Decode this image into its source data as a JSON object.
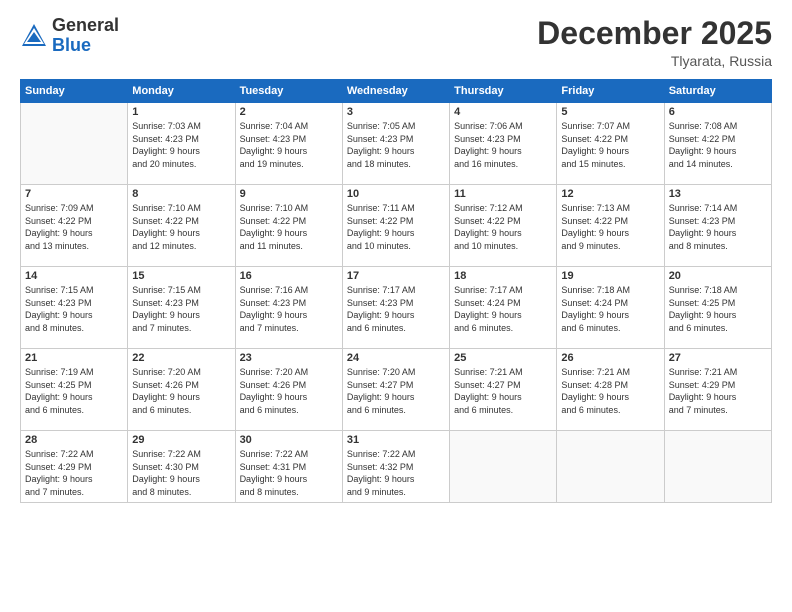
{
  "logo": {
    "general": "General",
    "blue": "Blue"
  },
  "header": {
    "month": "December 2025",
    "location": "Tlyarata, Russia"
  },
  "weekdays": [
    "Sunday",
    "Monday",
    "Tuesday",
    "Wednesday",
    "Thursday",
    "Friday",
    "Saturday"
  ],
  "weeks": [
    [
      {
        "day": "",
        "info": ""
      },
      {
        "day": "1",
        "info": "Sunrise: 7:03 AM\nSunset: 4:23 PM\nDaylight: 9 hours\nand 20 minutes."
      },
      {
        "day": "2",
        "info": "Sunrise: 7:04 AM\nSunset: 4:23 PM\nDaylight: 9 hours\nand 19 minutes."
      },
      {
        "day": "3",
        "info": "Sunrise: 7:05 AM\nSunset: 4:23 PM\nDaylight: 9 hours\nand 18 minutes."
      },
      {
        "day": "4",
        "info": "Sunrise: 7:06 AM\nSunset: 4:23 PM\nDaylight: 9 hours\nand 16 minutes."
      },
      {
        "day": "5",
        "info": "Sunrise: 7:07 AM\nSunset: 4:22 PM\nDaylight: 9 hours\nand 15 minutes."
      },
      {
        "day": "6",
        "info": "Sunrise: 7:08 AM\nSunset: 4:22 PM\nDaylight: 9 hours\nand 14 minutes."
      }
    ],
    [
      {
        "day": "7",
        "info": "Sunrise: 7:09 AM\nSunset: 4:22 PM\nDaylight: 9 hours\nand 13 minutes."
      },
      {
        "day": "8",
        "info": "Sunrise: 7:10 AM\nSunset: 4:22 PM\nDaylight: 9 hours\nand 12 minutes."
      },
      {
        "day": "9",
        "info": "Sunrise: 7:10 AM\nSunset: 4:22 PM\nDaylight: 9 hours\nand 11 minutes."
      },
      {
        "day": "10",
        "info": "Sunrise: 7:11 AM\nSunset: 4:22 PM\nDaylight: 9 hours\nand 10 minutes."
      },
      {
        "day": "11",
        "info": "Sunrise: 7:12 AM\nSunset: 4:22 PM\nDaylight: 9 hours\nand 10 minutes."
      },
      {
        "day": "12",
        "info": "Sunrise: 7:13 AM\nSunset: 4:22 PM\nDaylight: 9 hours\nand 9 minutes."
      },
      {
        "day": "13",
        "info": "Sunrise: 7:14 AM\nSunset: 4:23 PM\nDaylight: 9 hours\nand 8 minutes."
      }
    ],
    [
      {
        "day": "14",
        "info": "Sunrise: 7:15 AM\nSunset: 4:23 PM\nDaylight: 9 hours\nand 8 minutes."
      },
      {
        "day": "15",
        "info": "Sunrise: 7:15 AM\nSunset: 4:23 PM\nDaylight: 9 hours\nand 7 minutes."
      },
      {
        "day": "16",
        "info": "Sunrise: 7:16 AM\nSunset: 4:23 PM\nDaylight: 9 hours\nand 7 minutes."
      },
      {
        "day": "17",
        "info": "Sunrise: 7:17 AM\nSunset: 4:23 PM\nDaylight: 9 hours\nand 6 minutes."
      },
      {
        "day": "18",
        "info": "Sunrise: 7:17 AM\nSunset: 4:24 PM\nDaylight: 9 hours\nand 6 minutes."
      },
      {
        "day": "19",
        "info": "Sunrise: 7:18 AM\nSunset: 4:24 PM\nDaylight: 9 hours\nand 6 minutes."
      },
      {
        "day": "20",
        "info": "Sunrise: 7:18 AM\nSunset: 4:25 PM\nDaylight: 9 hours\nand 6 minutes."
      }
    ],
    [
      {
        "day": "21",
        "info": "Sunrise: 7:19 AM\nSunset: 4:25 PM\nDaylight: 9 hours\nand 6 minutes."
      },
      {
        "day": "22",
        "info": "Sunrise: 7:20 AM\nSunset: 4:26 PM\nDaylight: 9 hours\nand 6 minutes."
      },
      {
        "day": "23",
        "info": "Sunrise: 7:20 AM\nSunset: 4:26 PM\nDaylight: 9 hours\nand 6 minutes."
      },
      {
        "day": "24",
        "info": "Sunrise: 7:20 AM\nSunset: 4:27 PM\nDaylight: 9 hours\nand 6 minutes."
      },
      {
        "day": "25",
        "info": "Sunrise: 7:21 AM\nSunset: 4:27 PM\nDaylight: 9 hours\nand 6 minutes."
      },
      {
        "day": "26",
        "info": "Sunrise: 7:21 AM\nSunset: 4:28 PM\nDaylight: 9 hours\nand 6 minutes."
      },
      {
        "day": "27",
        "info": "Sunrise: 7:21 AM\nSunset: 4:29 PM\nDaylight: 9 hours\nand 7 minutes."
      }
    ],
    [
      {
        "day": "28",
        "info": "Sunrise: 7:22 AM\nSunset: 4:29 PM\nDaylight: 9 hours\nand 7 minutes."
      },
      {
        "day": "29",
        "info": "Sunrise: 7:22 AM\nSunset: 4:30 PM\nDaylight: 9 hours\nand 8 minutes."
      },
      {
        "day": "30",
        "info": "Sunrise: 7:22 AM\nSunset: 4:31 PM\nDaylight: 9 hours\nand 8 minutes."
      },
      {
        "day": "31",
        "info": "Sunrise: 7:22 AM\nSunset: 4:32 PM\nDaylight: 9 hours\nand 9 minutes."
      },
      {
        "day": "",
        "info": ""
      },
      {
        "day": "",
        "info": ""
      },
      {
        "day": "",
        "info": ""
      }
    ]
  ]
}
